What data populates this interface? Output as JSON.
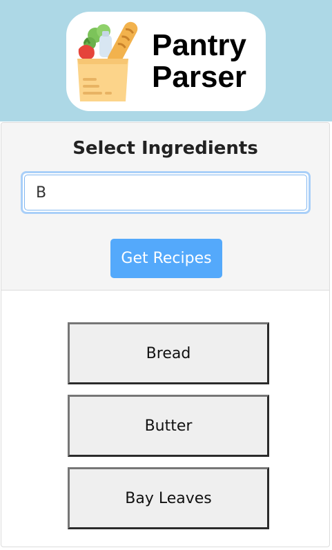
{
  "header": {
    "logo": {
      "icon": "grocery-bag-icon",
      "line1": "Pantry",
      "line2": "Parser"
    },
    "background_color": "#add8e6"
  },
  "ingredients_panel": {
    "title": "Select Ingredients",
    "search": {
      "value": "B",
      "placeholder": ""
    },
    "submit_button_label": "Get Recipes",
    "button_color": "#54a9fb"
  },
  "suggestions": [
    {
      "label": "Bread"
    },
    {
      "label": "Butter"
    },
    {
      "label": "Bay Leaves"
    }
  ]
}
